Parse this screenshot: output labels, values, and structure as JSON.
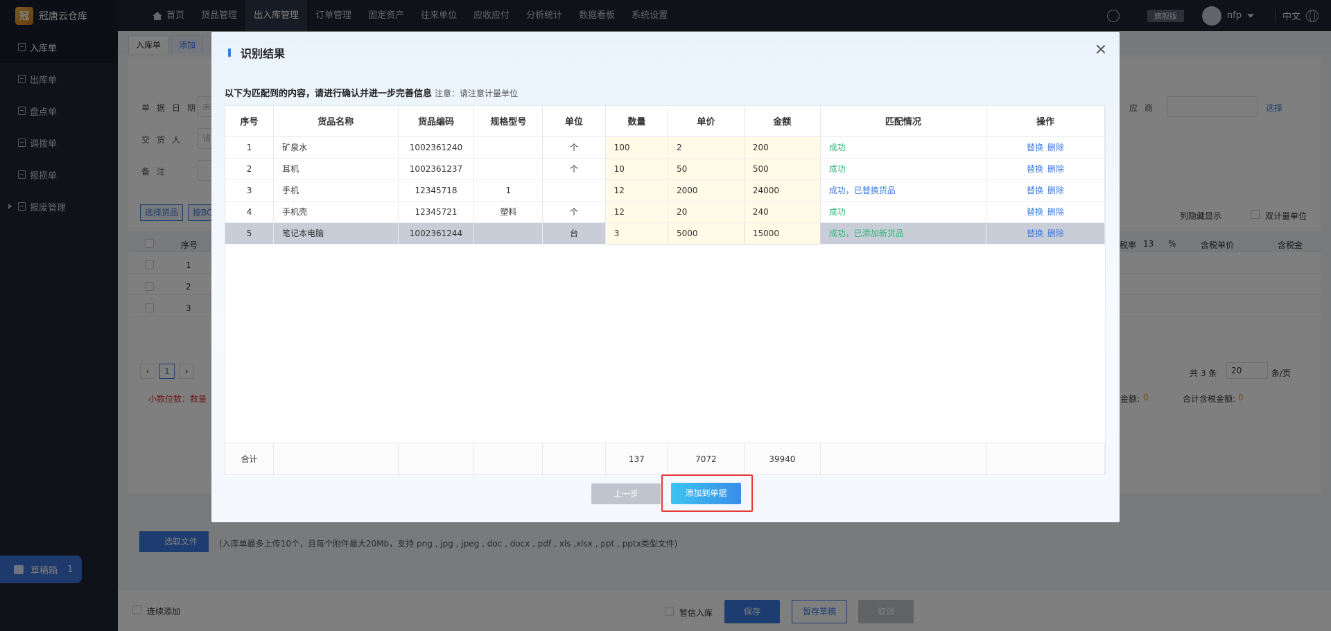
{
  "app": {
    "name": "冠唐云仓库",
    "logo_char": "冠"
  },
  "nav": {
    "home": "首页",
    "items": [
      "货品管理",
      "出入库管理",
      "订单管理",
      "固定资产",
      "往来单位",
      "应收应付",
      "分析统计",
      "数据看板",
      "系统设置"
    ],
    "active": "出入库管理"
  },
  "topbar": {
    "edition": "旗舰版",
    "user": "nfp",
    "language": "中文"
  },
  "sidebar": {
    "items": [
      "入库单",
      "出库单",
      "盘点单",
      "调拨单",
      "报损单",
      "报废管理"
    ],
    "drafts_label": "草稿箱",
    "drafts_count": "1"
  },
  "tabs": [
    "入库单",
    "添加"
  ],
  "background_form": {
    "doc_date_label": "单据日期",
    "doc_date_placeholder": "未",
    "supplier_label": "应商",
    "choose_link": "选择",
    "deliverer_label": "交货人",
    "deliverer_placeholder": "请",
    "remark_label": "备注",
    "select_goods_btn": "选择货品",
    "bom_btn": "按BO",
    "show_hidden": "列隐藏显示",
    "dual_unit": "双计量单位",
    "col_seq": "序号",
    "col_tax_rate": "税率",
    "tax_rate_value": "13",
    "percent": "%",
    "col_tax_price": "含税单价",
    "col_tax_amount": "含税金",
    "rows": [
      "1",
      "2",
      "3"
    ],
    "page_current": "1",
    "total_text": "共 3 条",
    "page_size": "20",
    "per_page": "条/页",
    "decimal_note": "小数位数：数量",
    "tax_amount_label": "金额:",
    "tax_amount_value": "0",
    "total_tax_label": "合计含税金额:",
    "total_tax_value": "0",
    "upload_btn": "选取文件",
    "upload_tip": "(入库单最多上传10个，且每个附件最大20Mb，支持 png , jpg , jpeg , doc , docx , pdf , xls ,xlsx , ppt , pptx类型文件)",
    "continuous_add": "连续添加",
    "temp_estimate": "暂估入库",
    "save_btn": "保存",
    "save_draft_btn": "暂存草稿",
    "cancel_btn": "取消"
  },
  "modal": {
    "title": "识别结果",
    "instruction": "以下为匹配到的内容，请进行确认并进一步完善信息",
    "note": "注意：请注意计量单位",
    "columns": [
      "序号",
      "货品名称",
      "货品编码",
      "规格型号",
      "单位",
      "数量",
      "单价",
      "金额",
      "匹配情况",
      "操作"
    ],
    "rows": [
      {
        "seq": "1",
        "name": "矿泉水",
        "code": "1002361240",
        "spec": "",
        "unit": "个",
        "qty": "100",
        "price": "2",
        "amount": "200",
        "match": "成功"
      },
      {
        "seq": "2",
        "name": "耳机",
        "code": "1002361237",
        "spec": "",
        "unit": "个",
        "qty": "10",
        "price": "50",
        "amount": "500",
        "match": "成功"
      },
      {
        "seq": "3",
        "name": "手机",
        "code": "12345718",
        "spec": "1",
        "unit": "",
        "qty": "12",
        "price": "2000",
        "amount": "24000",
        "match": "成功，已替换货品"
      },
      {
        "seq": "4",
        "name": "手机壳",
        "code": "12345721",
        "spec": "塑料",
        "unit": "个",
        "qty": "12",
        "price": "20",
        "amount": "240",
        "match": "成功"
      },
      {
        "seq": "5",
        "name": "笔记本电脑",
        "code": "1002361244",
        "spec": "",
        "unit": "台",
        "qty": "3",
        "price": "5000",
        "amount": "15000",
        "match": "成功，已添加新货品"
      }
    ],
    "op_replace": "替换",
    "op_delete": "删除",
    "summary": {
      "label": "合计",
      "qty": "137",
      "price": "7072",
      "amount": "39940"
    },
    "btn_prev": "上一步",
    "btn_add": "添加到单据"
  }
}
